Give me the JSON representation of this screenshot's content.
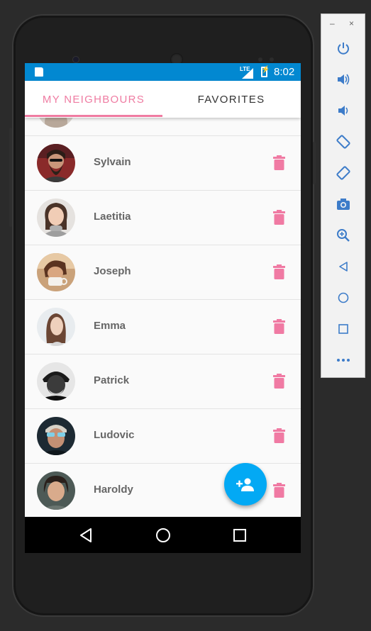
{
  "status_bar": {
    "network": "LTE",
    "time": "8:02"
  },
  "tabs": [
    {
      "label": "MY NEIGHBOURS",
      "active": true
    },
    {
      "label": "FAVORITES",
      "active": false
    }
  ],
  "neighbours": [
    {
      "name": "Sylvain"
    },
    {
      "name": "Laetitia"
    },
    {
      "name": "Joseph"
    },
    {
      "name": "Emma"
    },
    {
      "name": "Patrick"
    },
    {
      "name": "Ludovic"
    },
    {
      "name": "Haroldy"
    }
  ],
  "icons": {
    "delete": "trash-icon",
    "fab": "add-person-icon",
    "nav_back": "back-triangle-icon",
    "nav_home": "home-circle-icon",
    "nav_recents": "recents-square-icon"
  },
  "emulator_panel": {
    "minimize": "–",
    "close": "×",
    "buttons": [
      "power",
      "volume-up",
      "volume-down",
      "rotate-left",
      "rotate-right",
      "screenshot",
      "zoom",
      "back",
      "home",
      "overview",
      "more"
    ]
  },
  "colors": {
    "accent_pink": "#ef7ca2",
    "status_bar_blue": "#0288d1",
    "fab_blue": "#03a9f4",
    "emulator_icon_blue": "#3d7cc9"
  }
}
